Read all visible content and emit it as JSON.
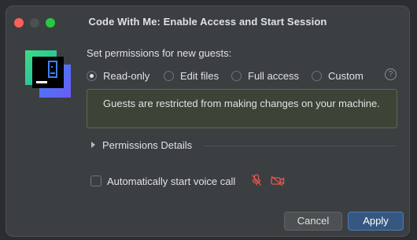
{
  "dialog": {
    "title": "Code With Me: Enable Access and Start Session",
    "heading": "Set permissions for new guests:",
    "permissions": [
      {
        "label": "Read-only",
        "checked": true
      },
      {
        "label": "Edit files",
        "checked": false
      },
      {
        "label": "Full access",
        "checked": false
      },
      {
        "label": "Custom",
        "checked": false
      }
    ],
    "help_glyph": "?",
    "info_text": "Guests are restricted from making changes on your machine.",
    "details_label": "Permissions Details",
    "voice_call": {
      "label": "Automatically start voice call",
      "checked": false
    },
    "buttons": {
      "cancel": "Cancel",
      "apply": "Apply"
    }
  },
  "icons": {
    "logo": "code-with-me-logo",
    "help": "help-icon",
    "mic": "microphone-muted-icon",
    "camera": "camera-off-icon"
  },
  "colors": {
    "dialog_bg": "#3c3f41",
    "info_bg": "#3b4436",
    "apply_bg": "#365880",
    "muted_red": "#e5574f",
    "traffic_close": "#ff5f57",
    "traffic_max": "#28c840"
  }
}
